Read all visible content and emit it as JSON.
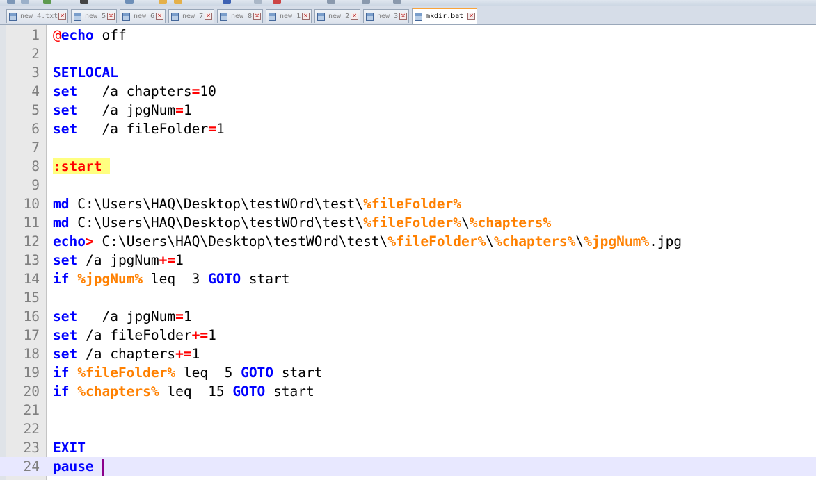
{
  "tabs": [
    {
      "label": "new 4.txt",
      "active": false
    },
    {
      "label": "new 5",
      "active": false
    },
    {
      "label": "new 6",
      "active": false
    },
    {
      "label": "new 7",
      "active": false
    },
    {
      "label": "new 8",
      "active": false
    },
    {
      "label": "new 1",
      "active": false
    },
    {
      "label": "new 2",
      "active": false
    },
    {
      "label": "new 3",
      "active": false
    },
    {
      "label": "mkdir.bat",
      "active": true
    }
  ],
  "editor": {
    "current_line": 24,
    "lines": [
      {
        "n": "1",
        "t": [
          [
            "at",
            "@"
          ],
          [
            "kw",
            "echo"
          ],
          [
            "",
            "off"
          ]
        ]
      },
      {
        "n": "2",
        "t": []
      },
      {
        "n": "3",
        "t": [
          [
            "kw",
            "SETLOCAL"
          ]
        ]
      },
      {
        "n": "4",
        "t": [
          [
            "kw",
            "set"
          ],
          [
            "",
            "  /a chapters"
          ],
          [
            "op",
            "="
          ],
          [
            "",
            "10"
          ]
        ]
      },
      {
        "n": "5",
        "t": [
          [
            "kw",
            "set"
          ],
          [
            "",
            "  /a jpgNum"
          ],
          [
            "op",
            "="
          ],
          [
            "",
            "1"
          ]
        ]
      },
      {
        "n": "6",
        "t": [
          [
            "kw",
            "set"
          ],
          [
            "",
            "  /a fileFolder"
          ],
          [
            "op",
            "="
          ],
          [
            "",
            "1"
          ]
        ]
      },
      {
        "n": "7",
        "t": []
      },
      {
        "n": "8",
        "t": [
          [
            "lab",
            ":start "
          ]
        ]
      },
      {
        "n": "9",
        "t": []
      },
      {
        "n": "10",
        "t": [
          [
            "kw",
            "md"
          ],
          [
            "",
            "C:\\Users\\HAQ\\Desktop\\testWOrd\\test\\"
          ],
          [
            "var",
            "%fileFolder%"
          ]
        ]
      },
      {
        "n": "11",
        "t": [
          [
            "kw",
            "md"
          ],
          [
            "",
            "C:\\Users\\HAQ\\Desktop\\testWOrd\\test\\"
          ],
          [
            "var",
            "%fileFolder%"
          ],
          [
            "",
            "\\"
          ],
          [
            "var",
            "%chapters%"
          ]
        ]
      },
      {
        "n": "12",
        "t": [
          [
            "kw",
            "echo"
          ],
          [
            "op",
            ">"
          ],
          [
            "",
            "C:\\Users\\HAQ\\Desktop\\testWOrd\\test\\"
          ],
          [
            "var",
            "%fileFolder%"
          ],
          [
            "",
            "\\"
          ],
          [
            "var",
            "%chapters%"
          ],
          [
            "",
            "\\"
          ],
          [
            "var",
            "%jpgNum%"
          ],
          [
            "",
            ".jpg"
          ]
        ]
      },
      {
        "n": "13",
        "t": [
          [
            "kw",
            "set"
          ],
          [
            "",
            "/a jpgNum"
          ],
          [
            "op",
            "+="
          ],
          [
            "",
            "1"
          ]
        ]
      },
      {
        "n": "14",
        "t": [
          [
            "kw",
            "if"
          ],
          [
            "var",
            "%jpgNum%"
          ],
          [
            "",
            "leq  3"
          ],
          [
            "kw",
            "GOTO"
          ],
          [
            "",
            "start"
          ]
        ]
      },
      {
        "n": "15",
        "t": []
      },
      {
        "n": "16",
        "t": [
          [
            "kw",
            "set"
          ],
          [
            "",
            "  /a jpgNum"
          ],
          [
            "op",
            "="
          ],
          [
            "",
            "1"
          ]
        ]
      },
      {
        "n": "17",
        "t": [
          [
            "kw",
            "set"
          ],
          [
            "",
            "/a fileFolder"
          ],
          [
            "op",
            "+="
          ],
          [
            "",
            "1"
          ]
        ]
      },
      {
        "n": "18",
        "t": [
          [
            "kw",
            "set"
          ],
          [
            "",
            "/a chapters"
          ],
          [
            "op",
            "+="
          ],
          [
            "",
            "1"
          ]
        ]
      },
      {
        "n": "19",
        "t": [
          [
            "kw",
            "if"
          ],
          [
            "var",
            "%fileFolder%"
          ],
          [
            "",
            "leq  5"
          ],
          [
            "kw",
            "GOTO"
          ],
          [
            "",
            "start"
          ]
        ]
      },
      {
        "n": "20",
        "t": [
          [
            "kw",
            "if"
          ],
          [
            "var",
            "%chapters%"
          ],
          [
            "",
            "leq  15"
          ],
          [
            "kw",
            "GOTO"
          ],
          [
            "",
            "start"
          ]
        ]
      },
      {
        "n": "21",
        "t": []
      },
      {
        "n": "22",
        "t": []
      },
      {
        "n": "23",
        "t": [
          [
            "kw",
            "EXIT"
          ]
        ]
      },
      {
        "n": "24",
        "t": [
          [
            "kw",
            "pause"
          ],
          [
            "",
            ""
          ]
        ]
      }
    ]
  },
  "colors": {
    "keyword": "#0000ff",
    "operator": "#ff0000",
    "variable": "#ff8000",
    "label_highlight": "#ffff80",
    "current_line": "#e8e8ff",
    "active_tab_accent": "#f9a33a"
  },
  "icons": [
    "file-icon",
    "close-icon",
    "caret"
  ]
}
